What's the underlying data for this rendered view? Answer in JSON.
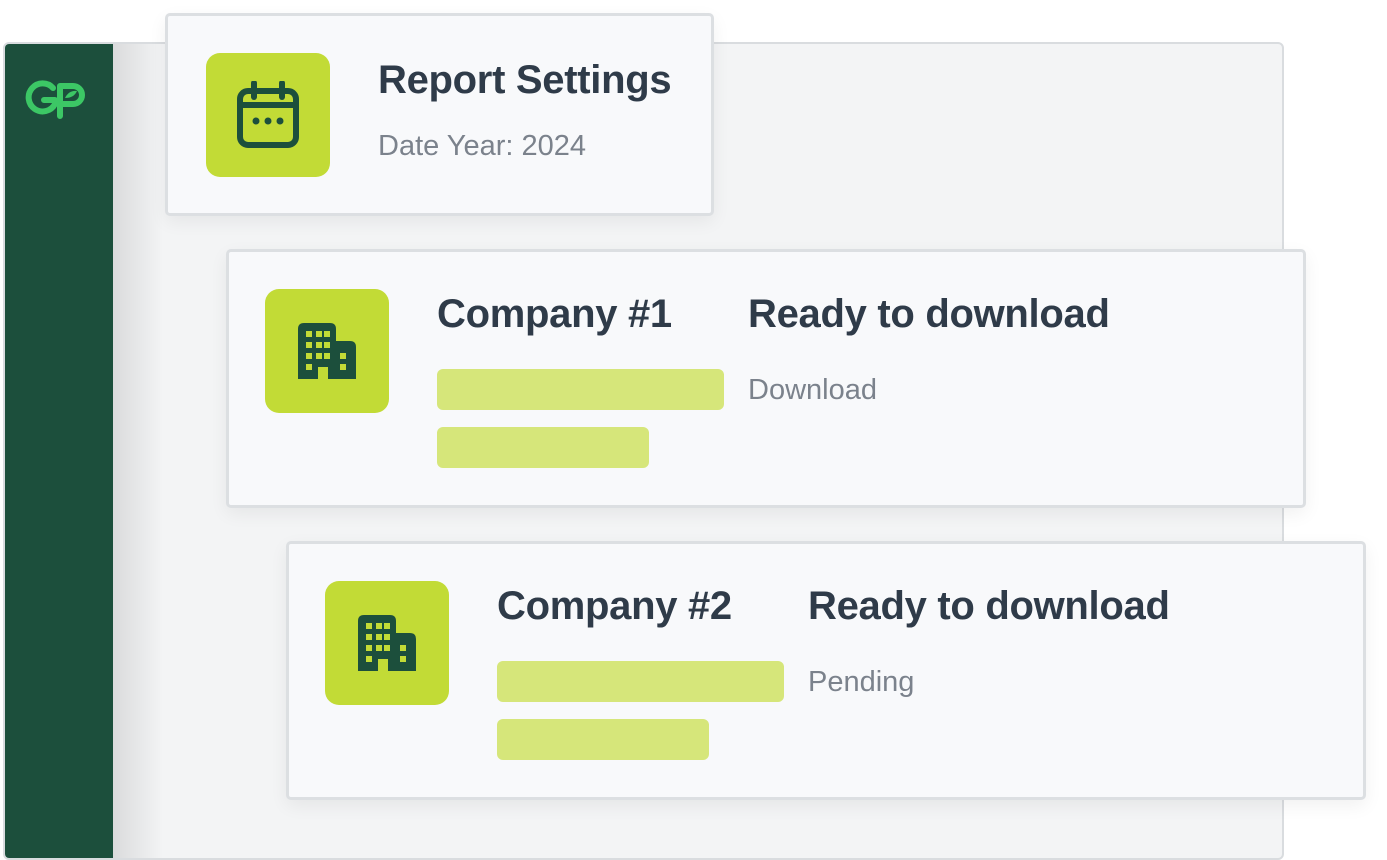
{
  "brand": {
    "logo_text": "GP",
    "sidebar_color": "#1c4f3c",
    "accent_color": "#c2db36",
    "logo_color": "#3cc765"
  },
  "report_settings": {
    "title": "Report Settings",
    "subtitle": "Date Year: 2024",
    "icon": "calendar-icon"
  },
  "companies": [
    {
      "name": "Company #1",
      "status_title": "Ready to download",
      "status_text": "Download",
      "icon": "building-icon"
    },
    {
      "name": "Company #2",
      "status_title": "Ready to download",
      "status_text": "Pending",
      "icon": "building-icon"
    }
  ]
}
